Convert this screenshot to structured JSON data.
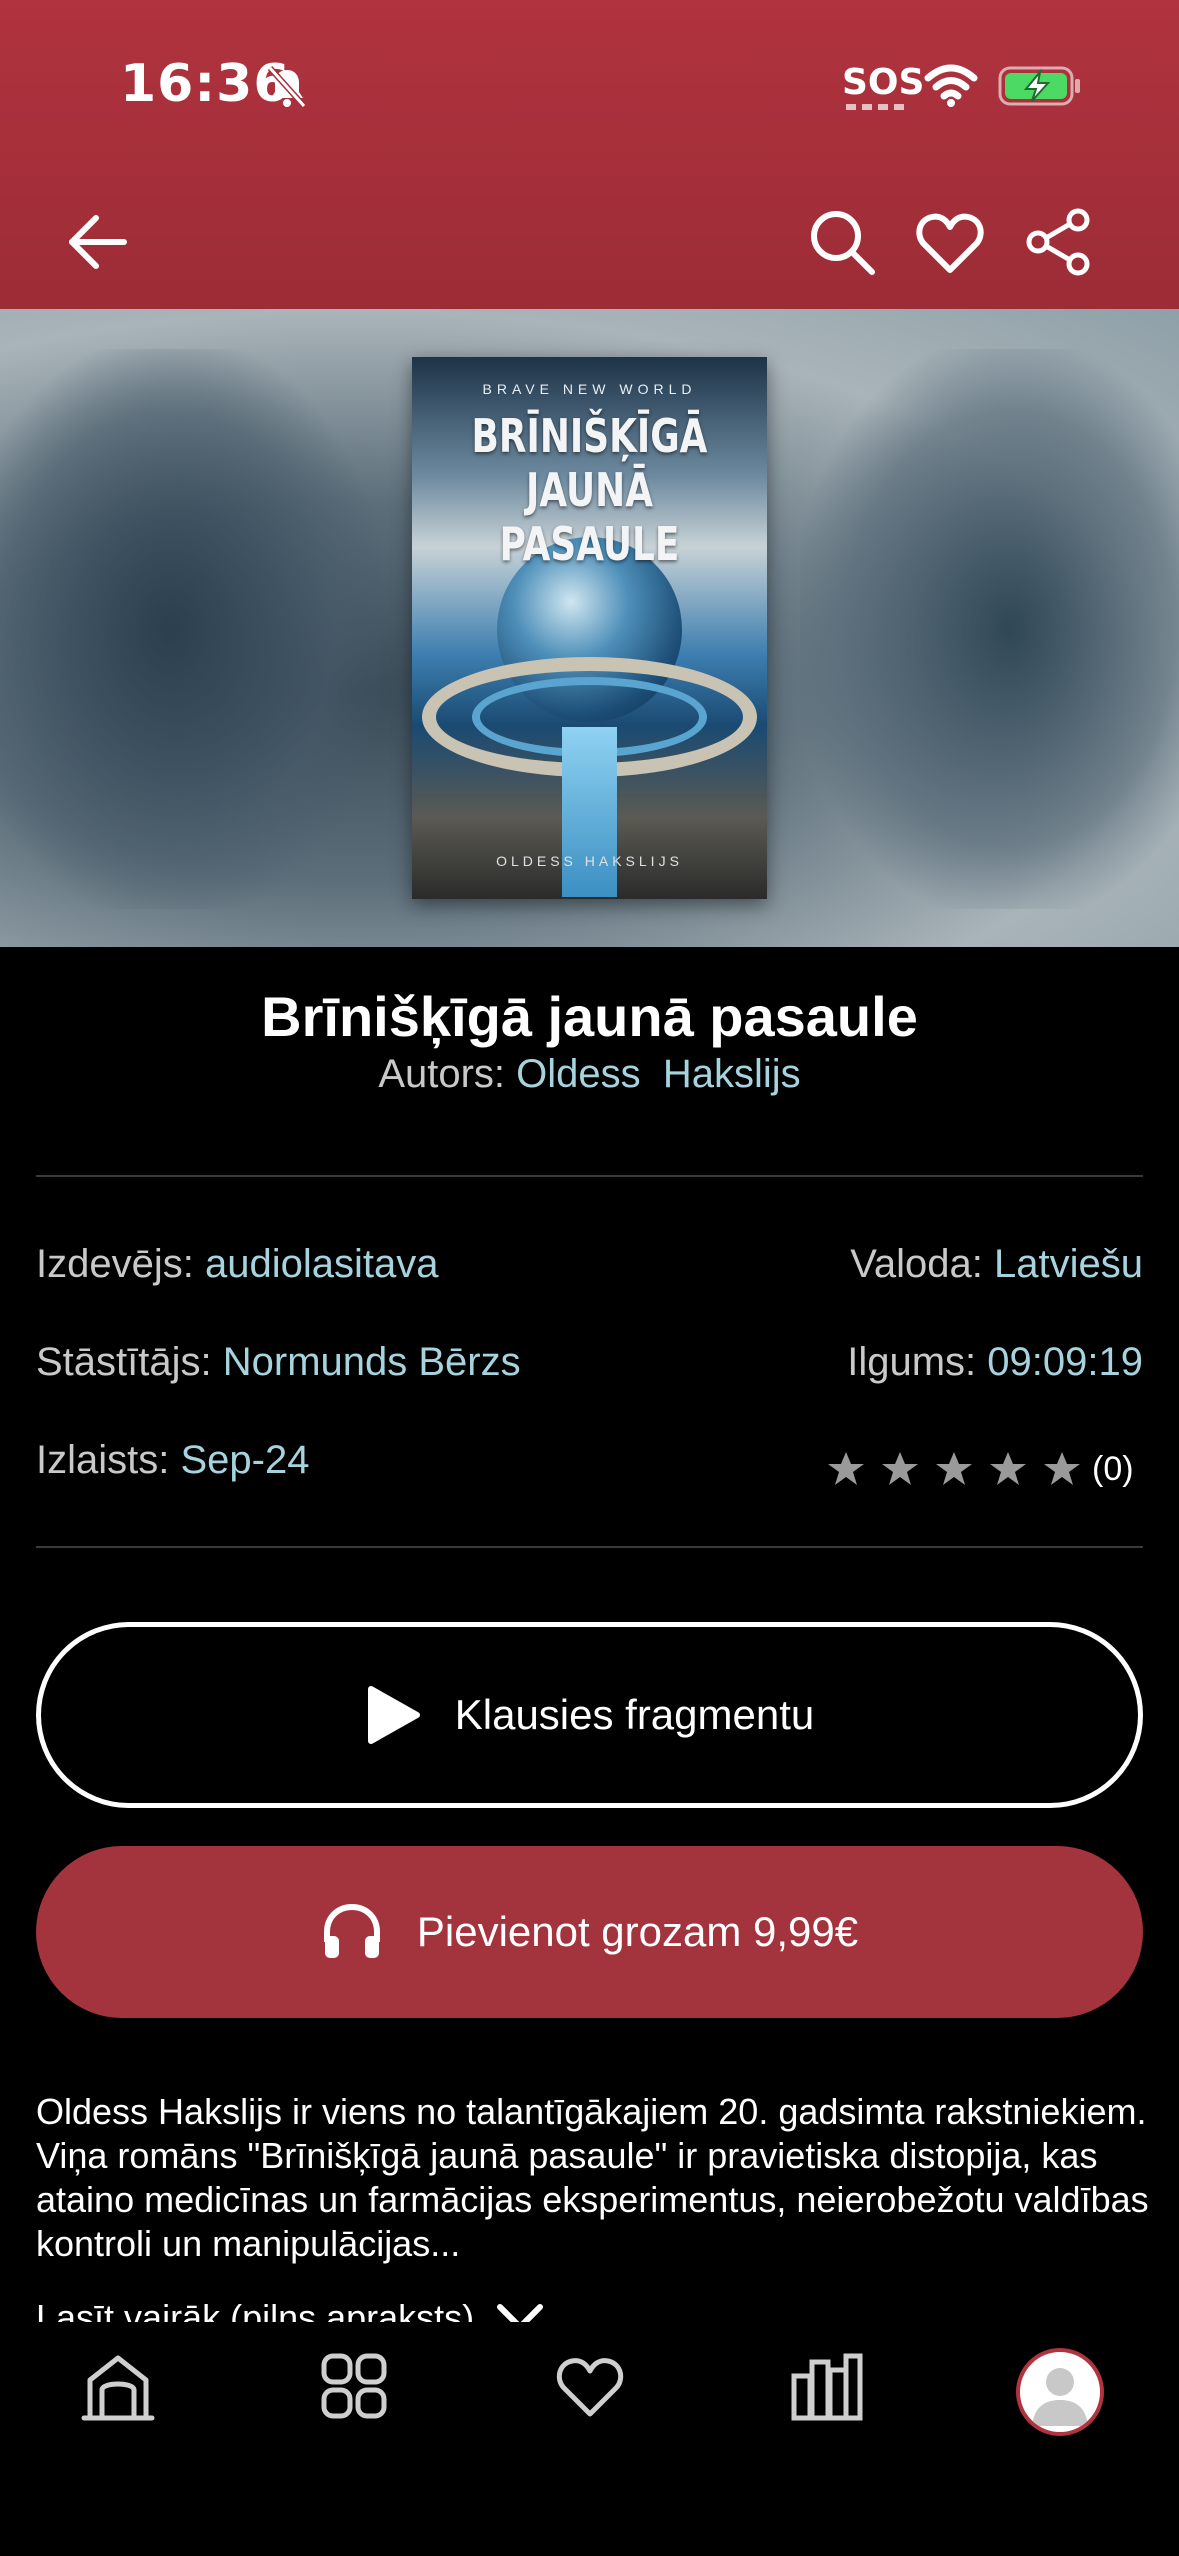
{
  "status_bar": {
    "time": "16:36",
    "carrier_text": "SOS"
  },
  "book": {
    "title": "Brīnišķīgā jaunā pasaule",
    "author_label": "Autors:",
    "author": "Oldess  Hakslijs",
    "cover": {
      "top_text": "BRAVE NEW WORLD",
      "title_line1": "BRĪNIŠĶĪGĀ",
      "title_line2": "JAUNĀ PASAULE",
      "author_text": "OLDESS HAKSLIJS"
    }
  },
  "details": {
    "publisher_label": "Izdevējs:",
    "publisher": "audiolasitava",
    "language_label": "Valoda:",
    "language": "Latviešu",
    "narrator_label": "Stāstītājs:",
    "narrator": "Normunds Bērzs",
    "duration_label": "Ilgums:",
    "duration": "09:09:19",
    "released_label": "Izlaists:",
    "released": "Sep-24",
    "rating_value": 0,
    "rating_count": "(0)"
  },
  "actions": {
    "sample_label": "Klausies fragmentu",
    "add_to_cart_label": "Pievienot grozam 9,99€"
  },
  "description": {
    "text": "Oldess Hakslijs ir viens no talantīgākajiem 20. gadsimta rakstniekiem. Viņa romāns \"Brīnišķīgā jaunā pasaule\" ir pravietiska distopija, kas ataino medicīnas un farmācijas eksperimentus, neierobežotu valdības kontroli un manipulācijas...",
    "read_more": "Lasīt vairāk (pilns apraksts)"
  },
  "colors": {
    "header": "#a3333d",
    "accent_link": "#a6d3de",
    "background": "#000000"
  },
  "icons": [
    "back-arrow-icon",
    "search-icon",
    "heart-icon",
    "share-icon",
    "play-icon",
    "headphones-icon",
    "star-icon",
    "home-icon",
    "categories-icon",
    "favorites-icon",
    "library-icon",
    "profile-icon"
  ]
}
